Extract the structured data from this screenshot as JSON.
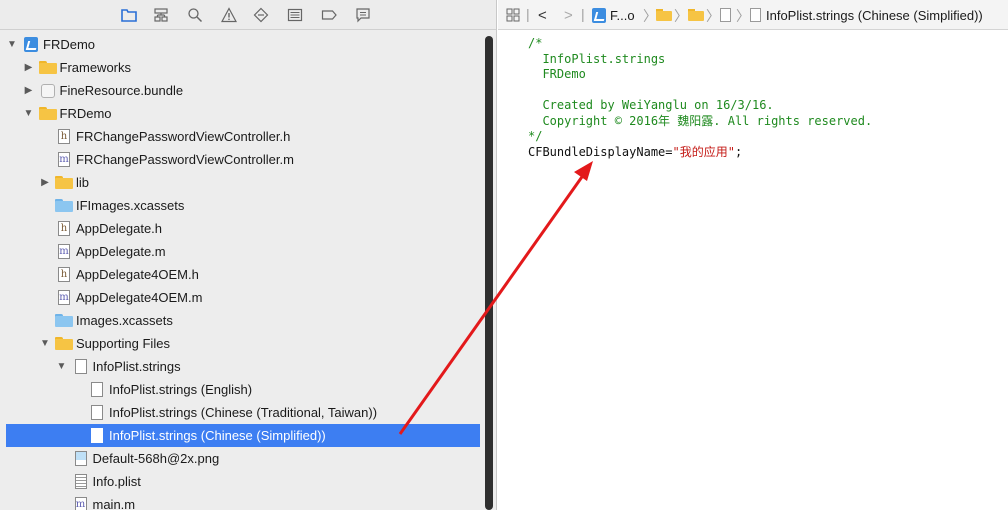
{
  "navigator": {
    "toolbar_icons": [
      "folder-icon",
      "hierarchy-icon",
      "search-icon",
      "warning-icon",
      "diamond-icon",
      "list-icon",
      "tag-icon",
      "comment-icon"
    ],
    "tree": [
      {
        "label": "FRDemo",
        "icon": "project-icon",
        "disclosure": "open"
      },
      {
        "label": "Frameworks",
        "icon": "folder-icon",
        "disclosure": "closed"
      },
      {
        "label": "FineResource.bundle",
        "icon": "bundle-icon",
        "disclosure": "closed"
      },
      {
        "label": "FRDemo",
        "icon": "folder-icon",
        "disclosure": "open"
      },
      {
        "label": "FRChangePasswordViewController.h",
        "icon": "header-file-icon",
        "glyph": "h"
      },
      {
        "label": "FRChangePasswordViewController.m",
        "icon": "source-file-icon",
        "glyph": "m"
      },
      {
        "label": "lib",
        "icon": "folder-icon",
        "disclosure": "closed"
      },
      {
        "label": "IFImages.xcassets",
        "icon": "asset-catalog-icon"
      },
      {
        "label": "AppDelegate.h",
        "icon": "header-file-icon",
        "glyph": "h"
      },
      {
        "label": "AppDelegate.m",
        "icon": "source-file-icon",
        "glyph": "m"
      },
      {
        "label": "AppDelegate4OEM.h",
        "icon": "header-file-icon",
        "glyph": "h"
      },
      {
        "label": "AppDelegate4OEM.m",
        "icon": "source-file-icon",
        "glyph": "m"
      },
      {
        "label": "Images.xcassets",
        "icon": "asset-catalog-icon"
      },
      {
        "label": "Supporting Files",
        "icon": "folder-icon",
        "disclosure": "open"
      },
      {
        "label": "InfoPlist.strings",
        "icon": "strings-file-icon",
        "disclosure": "open"
      },
      {
        "label": "InfoPlist.strings (English)",
        "icon": "strings-file-icon"
      },
      {
        "label": "InfoPlist.strings (Chinese (Traditional, Taiwan))",
        "icon": "strings-file-icon"
      },
      {
        "label": "InfoPlist.strings (Chinese (Simplified))",
        "icon": "strings-file-icon",
        "selected": true
      },
      {
        "label": "Default-568h@2x.png",
        "icon": "image-file-icon"
      },
      {
        "label": "Info.plist",
        "icon": "plist-file-icon"
      },
      {
        "label": "main.m",
        "icon": "source-file-icon",
        "glyph": "m"
      }
    ]
  },
  "jumpbar": {
    "back_label": "<",
    "forward_label": ">",
    "project_crumb": "F...o",
    "file_crumb": "InfoPlist.strings (Chinese (Simplified))"
  },
  "editor": {
    "lines": [
      {
        "text": "/*",
        "kind": "comment"
      },
      {
        "text": "  InfoPlist.strings",
        "kind": "comment"
      },
      {
        "text": "  FRDemo",
        "kind": "comment"
      },
      {
        "text": "",
        "kind": "comment"
      },
      {
        "text": "  Created by WeiYanglu on 16/3/16.",
        "kind": "comment"
      },
      {
        "text": "  Copyright © 2016年 魏阳露. All rights reserved.",
        "kind": "comment"
      },
      {
        "text": "*/",
        "kind": "comment"
      }
    ],
    "key_line": {
      "key": "CFBundleDisplayName=",
      "value": "\"我的应用\"",
      "terminator": ";"
    }
  },
  "colors": {
    "selection": "#3d7ef2",
    "comment": "#1f8a1f",
    "string": "#c41a16",
    "annotation_arrow": "#e3191b"
  }
}
